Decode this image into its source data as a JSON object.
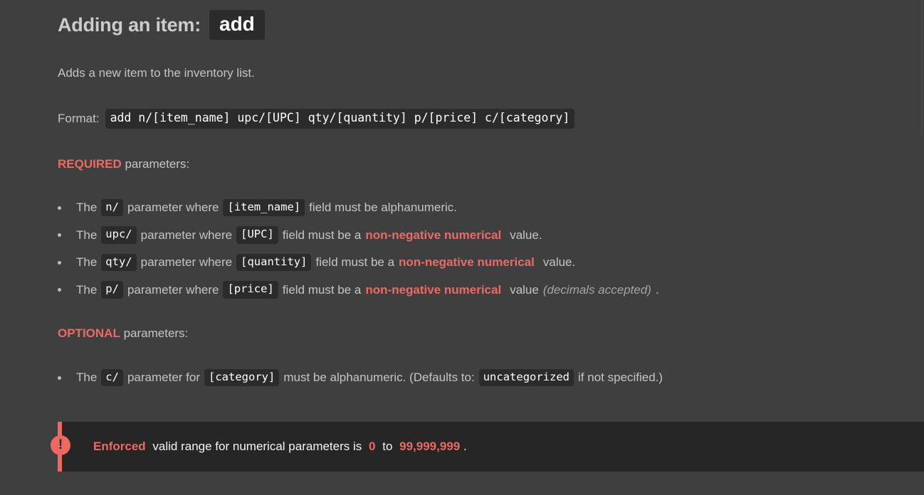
{
  "page": {
    "background": "#3f3f3f",
    "accent_red": "#ec6a62",
    "code_background": "#2b2b2b",
    "callout_background": "#262626"
  },
  "header": {
    "title": "Adding an item:",
    "command_chip": "add"
  },
  "intro": "Adds a new item to the inventory list.",
  "format": {
    "label": "Format:",
    "value": "add n/[item_name] upc/[UPC] qty/[quantity] p/[price] c/[category]"
  },
  "required_section": {
    "keyword": "REQUIRED",
    "heading_suffix": "parameters:",
    "items": [
      {
        "lead": "The",
        "param": "n/",
        "mid": "parameter where",
        "field": "[item_name]",
        "tail": "field must be alphanumeric.",
        "emphasis": "",
        "tail2": "",
        "note": ""
      },
      {
        "lead": "The",
        "param": "upc/",
        "mid": "parameter where",
        "field": "[UPC]",
        "tail": "field must be a",
        "emphasis": "non-negative numerical",
        "tail2": "value.",
        "note": ""
      },
      {
        "lead": "The",
        "param": "qty/",
        "mid": "parameter where",
        "field": "[quantity]",
        "tail": "field must be a",
        "emphasis": "non-negative numerical",
        "tail2": "value.",
        "note": ""
      },
      {
        "lead": "The",
        "param": "p/",
        "mid": "parameter where",
        "field": "[price]",
        "tail": "field must be a",
        "emphasis": "non-negative numerical",
        "tail2": "value",
        "note": "(decimals accepted)",
        "note_after": "."
      }
    ]
  },
  "optional_section": {
    "keyword": "OPTIONAL",
    "heading_suffix": "parameters:",
    "items": [
      {
        "lead": "The",
        "param": "c/",
        "mid": "parameter for",
        "field": "[category]",
        "tail": "must be alphanumeric. (Defaults to:",
        "default_value": "uncategorized",
        "tail2": "if not specified.)"
      }
    ]
  },
  "callout": {
    "icon": "!",
    "keyword": "Enforced",
    "text_before": "valid range for numerical parameters is",
    "min": "0",
    "conjunction": "to",
    "max": "99,999,999",
    "period": "."
  }
}
